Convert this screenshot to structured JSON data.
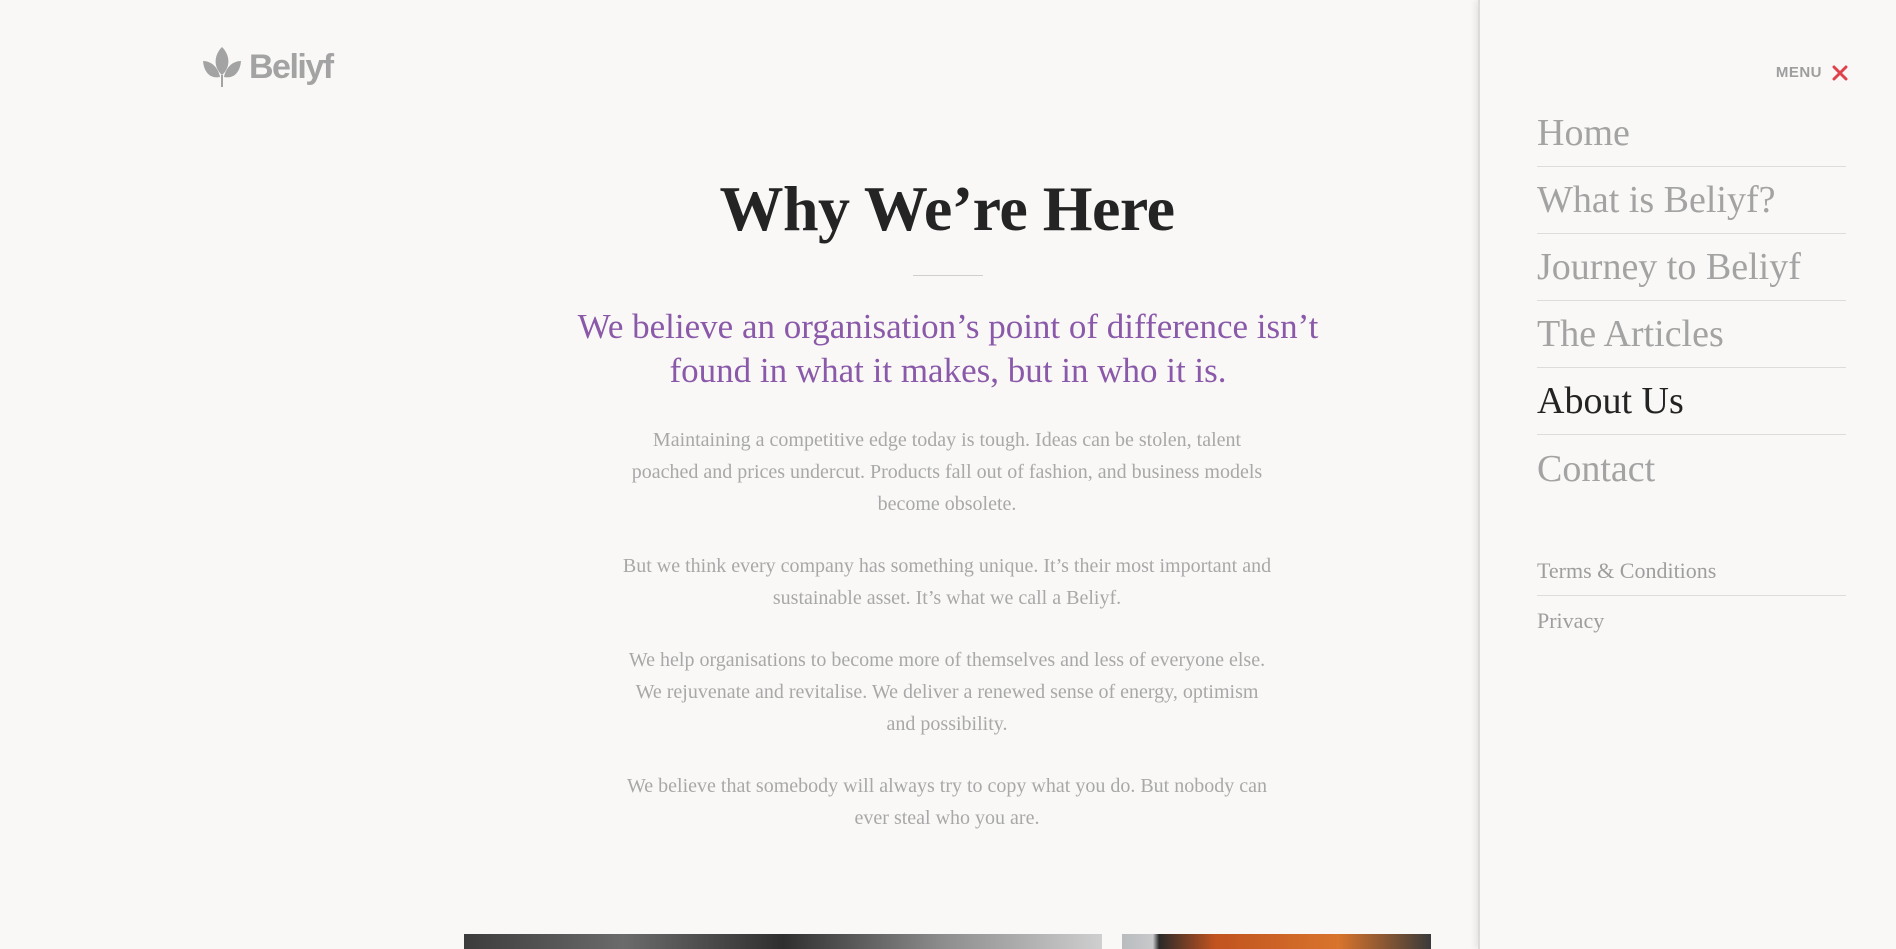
{
  "brand": {
    "name": "Beliyf",
    "logo_icon": "leaf-icon"
  },
  "content": {
    "title": "Why We’re Here",
    "lead": "We believe an organisation’s point of difference isn’t found in what it makes, but in who it is.",
    "paragraphs": [
      "Maintaining a competitive edge today is tough. Ideas can be stolen, talent poached and prices undercut. Products fall out of fashion, and business models become obsolete.",
      "But we think every company has something unique. It’s their most important and sustainable asset. It’s what we call a Beliyf.",
      "We help organisations to become more of themselves and less of everyone else. We rejuvenate and revitalise. We deliver a renewed sense of energy, optimism and possibility.",
      "We believe that somebody will always try to copy what you do. But nobody can ever steal who you are."
    ]
  },
  "menu": {
    "label": "MENU",
    "close_icon": "close-icon",
    "items": [
      {
        "label": "Home"
      },
      {
        "label": "What is Beliyf?"
      },
      {
        "label": "Journey to Beliyf"
      },
      {
        "label": "The Articles"
      },
      {
        "label": "About Us",
        "active": true
      },
      {
        "label": "Contact"
      }
    ],
    "secondary": [
      {
        "label": "Terms & Conditions"
      },
      {
        "label": "Privacy"
      }
    ]
  },
  "colors": {
    "background": "#f9f8f6",
    "accent_purple": "#8a59a9",
    "close_red": "#e0414a",
    "muted_text": "#a8a8a8",
    "heading": "#242424"
  }
}
